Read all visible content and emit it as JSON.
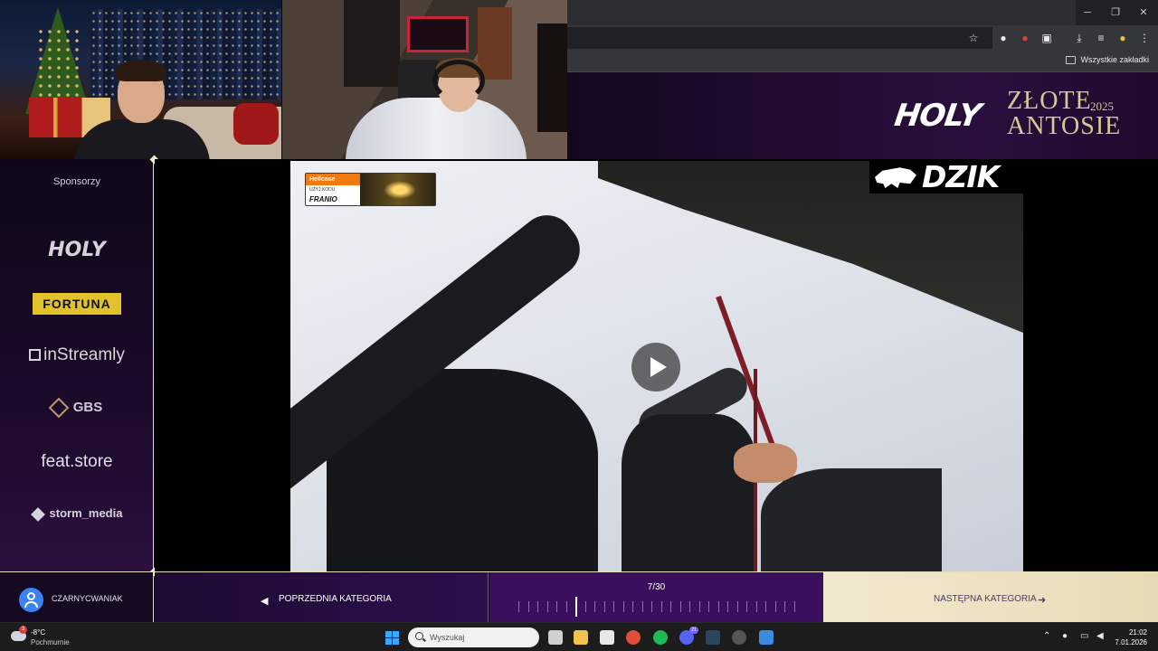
{
  "browser": {
    "bookmarks_bar": {
      "all_bookmarks_label": "Wszystkie zakładki"
    },
    "window_controls": {
      "minimize": "─",
      "restore": "❐",
      "close": "✕"
    }
  },
  "banner": {
    "brand": "HOLY",
    "title_line1": "ZŁOTE",
    "title_line2": "ANTOSIE",
    "year": "2025"
  },
  "sidebar": {
    "title": "Sponsorzy",
    "sponsors": [
      "HOLY",
      "FORTUNA",
      "inStreamly",
      "GBS",
      "feat.store",
      "storm_media"
    ]
  },
  "video": {
    "overlay_sponsor": {
      "brand": "Hellcase",
      "code_line1": "UŻYJ KODU",
      "code_line2": "FRANIO"
    },
    "corner_logo": "DZIK"
  },
  "bottom_bar": {
    "username": "CZARNYCWANIAK",
    "prev_label": "POPRZEDNIA KATEGORIA",
    "next_label": "NASTĘPNA KATEGORIA",
    "progress_label": "7/30",
    "progress": {
      "current": 7,
      "total": 30
    }
  },
  "taskbar": {
    "weather": {
      "temp": "-8°C",
      "condition": "Pochmurnie",
      "badge": "3"
    },
    "search_placeholder": "Wyszukaj",
    "discord_badge": "21",
    "clock": {
      "time": "21:02",
      "date": "7.01.2026"
    }
  },
  "colors": {
    "accent_purple": "#3a0f5e",
    "accent_gold": "#e9dec0",
    "fortuna_yellow": "#e2c22a",
    "hellcase_orange": "#f07a10"
  }
}
